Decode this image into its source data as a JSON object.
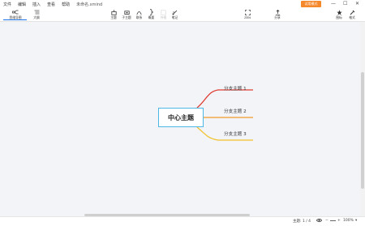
{
  "menu": {
    "items": [
      "文件",
      "编辑",
      "插入",
      "查看",
      "帮助"
    ],
    "file_name": "未命名.xmind"
  },
  "trial_button": "试用模式",
  "window_controls": [
    "—",
    "☐",
    "✕"
  ],
  "toolbar": {
    "left": [
      {
        "label": "思维导图",
        "icon": "mindmap-icon",
        "active": true
      },
      {
        "label": "大纲",
        "icon": "outline-icon",
        "active": false
      }
    ],
    "insert": [
      {
        "label": "主题",
        "icon": "topic-icon"
      },
      {
        "label": "子主题",
        "icon": "subtopic-icon"
      },
      {
        "label": "联系",
        "icon": "relationship-icon"
      },
      {
        "label": "概要",
        "icon": "summary-icon"
      },
      {
        "label": "外框",
        "icon": "boundary-icon",
        "disabled": true
      },
      {
        "label": "笔记",
        "icon": "notes-icon"
      }
    ],
    "zoom": {
      "label": "ZEN",
      "icon": "zen-icon"
    },
    "share": {
      "label": "分享",
      "icon": "share-icon"
    },
    "right": [
      {
        "label": "图标",
        "icon": "icon-panel-icon"
      },
      {
        "label": "格式",
        "icon": "format-icon"
      }
    ]
  },
  "mindmap": {
    "central_topic": "中心主题",
    "subtopics": [
      {
        "label": "分支主题 1",
        "color": "#e03c31"
      },
      {
        "label": "分支主题 2",
        "color": "#f19a2a"
      },
      {
        "label": "分支主题 3",
        "color": "#f3c12a"
      }
    ],
    "central_border_color": "#4db7e6"
  },
  "status": {
    "topic_count": "主题: 1 / 4",
    "zoom": "100%"
  }
}
